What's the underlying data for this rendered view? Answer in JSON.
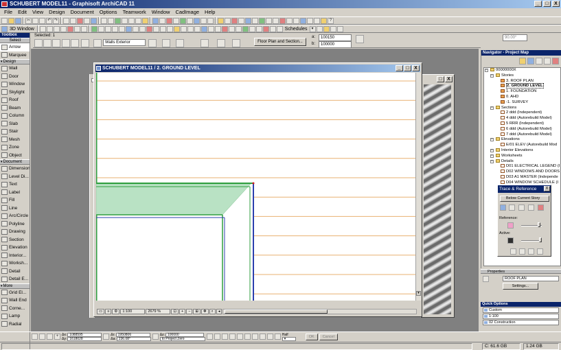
{
  "app": {
    "title": "SCHUBERT MODEL11 - Graphisoft ArchiCAD 11",
    "window_buttons": [
      "_",
      "□",
      "X"
    ]
  },
  "menu": [
    "File",
    "Edit",
    "View",
    "Design",
    "Document",
    "Options",
    "Teamwork",
    "Window",
    "CadImage",
    "Help"
  ],
  "toolbar": {
    "view_3d_label": "3D Window",
    "schedules_label": "Schedules",
    "selected_label": "Selected: 1",
    "floor_plan_section": "Floor Plan and Section...",
    "walls_exterior": "Walls Exterior"
  },
  "infobox": {
    "a_value": "100150",
    "b_value": "100000",
    "a_label": "a:",
    "b_label": "b:",
    "area_value": "90.00°"
  },
  "toolbox": {
    "title": "Toolbox",
    "select_label": "Select",
    "groups": [
      {
        "name": "",
        "tools": [
          "Arrow",
          "Marquee"
        ]
      },
      {
        "name": "Design",
        "tools": [
          "Wall",
          "Door",
          "Window",
          "Skylight",
          "Roof",
          "Beam",
          "Column",
          "Slab",
          "Stair",
          "Mesh",
          "Zone",
          "Object"
        ]
      },
      {
        "name": "Document",
        "tools": [
          "Dimension",
          "Level Di...",
          "Text",
          "Label",
          "Fill",
          "Line",
          "Arc/Circle",
          "Polyline",
          "Drawing",
          "Section",
          "Elevation",
          "Interior...",
          "Worksh...",
          "Detail",
          "Detail E..."
        ]
      },
      {
        "name": "More",
        "tools": [
          "Grid El...",
          "Wall End",
          "Corne...",
          "Lamp",
          "Radial"
        ]
      }
    ]
  },
  "drawing_window": {
    "title": "SCHUBERT MODEL11 / 2. GROUND LEVEL",
    "scale": "1:100",
    "zoom": "2679 %"
  },
  "navigator": {
    "title": "Navigator - Project Map",
    "tree": [
      {
        "label": "00000000X",
        "level": 0,
        "icon": "folder"
      },
      {
        "label": "Stories",
        "level": 1,
        "icon": "folder"
      },
      {
        "label": "3. ROOF PLAN",
        "level": 2,
        "icon": "story"
      },
      {
        "label": "2. GROUND LEVEL",
        "level": 2,
        "icon": "story",
        "selected": true
      },
      {
        "label": "1. FOUNDATION",
        "level": 2,
        "icon": "story"
      },
      {
        "label": "0. AHD",
        "level": 2,
        "icon": "story"
      },
      {
        "label": "-1. SURVEY",
        "level": 2,
        "icon": "story"
      },
      {
        "label": "Sections",
        "level": 1,
        "icon": "folder"
      },
      {
        "label": "2 ddd (Independent)",
        "level": 2,
        "icon": "sect"
      },
      {
        "label": "4 ddd (Autorebuild Model)",
        "level": 2,
        "icon": "sect"
      },
      {
        "label": "5 RRR (Independent)",
        "level": 2,
        "icon": "sect"
      },
      {
        "label": "6 ddd (Autorebuild Model)",
        "level": 2,
        "icon": "sect"
      },
      {
        "label": "7 ddd (Autorebuild Model)",
        "level": 2,
        "icon": "sect"
      },
      {
        "label": "Elevations",
        "level": 1,
        "icon": "folder"
      },
      {
        "label": "E/01 ELEV (Autorebuild Mod",
        "level": 2,
        "icon": "sect"
      },
      {
        "label": "Interior Elevations",
        "level": 1,
        "icon": "folder"
      },
      {
        "label": "Worksheets",
        "level": 1,
        "icon": "folder"
      },
      {
        "label": "Details",
        "level": 1,
        "icon": "folder"
      },
      {
        "label": "D01 ELECTRICAL LEGEND (I",
        "level": 2,
        "icon": "sect"
      },
      {
        "label": "D02 WINDOWS AND DOORS",
        "level": 2,
        "icon": "sect"
      },
      {
        "label": "D03 A1 MASTER (Independe",
        "level": 2,
        "icon": "sect"
      },
      {
        "label": "D04 WINDOW SCHEDULE (I",
        "level": 2,
        "icon": "sect"
      }
    ]
  },
  "trace": {
    "title": "Trace & Reference",
    "below_story": "Below Current Story",
    "reference_label": "Reference:",
    "active_label": "Active:",
    "close": "X"
  },
  "properties": {
    "title": "Properties",
    "story": "ROOF PLAN",
    "settings_button": "Settings..."
  },
  "quick_options": {
    "title": "Quick Options",
    "rows": [
      "Custom",
      "1:100",
      "02 Construction"
    ]
  },
  "coords": {
    "dx_label": "Δx:",
    "dx": "1088595",
    "dy_label": "Δy:",
    "dy": "1618028",
    "dr_label": "Δr:",
    "dr": "1950806",
    "da_label": "Δa:",
    "da": "236.08°",
    "dz_label": "Δz:",
    "dz": "100000",
    "zero_label": "to Project Zero",
    "half_label": "Half",
    "ok_label": "OK",
    "cancel_label": "Cancel"
  },
  "status": {
    "disk": "C: 61.6 GB",
    "mem": "1.24 GB"
  },
  "colors": {
    "title_blue": "#0a246a",
    "orange_line": "#e8b070",
    "wall_green": "#2e9e3e",
    "hatch_green": "#b9e2c4",
    "wall_blue": "#2b3fae"
  }
}
